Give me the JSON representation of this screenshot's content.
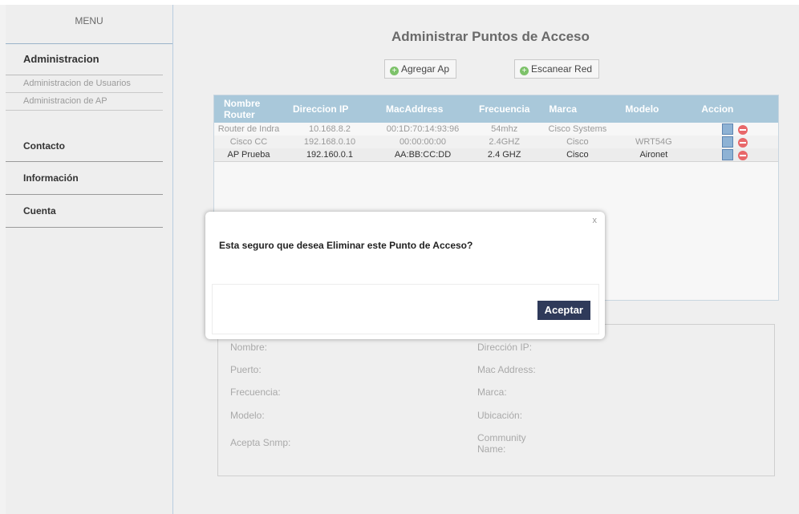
{
  "sidebar": {
    "title": "MENU",
    "admin": "Administracion",
    "sub": [
      "Administracion de Usuarios",
      "Administracion de AP"
    ],
    "contacto": "Contacto",
    "informacion": "Información",
    "cuenta": "Cuenta"
  },
  "main": {
    "title": "Administrar Puntos de Acceso",
    "add_label": "Agregar Ap",
    "scan_label": "Escanear Red",
    "columns": [
      "Nombre Router",
      "Direccion IP",
      "MacAddress",
      "Frecuencia",
      "Marca",
      "Modelo",
      "Accion"
    ],
    "rows": [
      [
        "Router de Indra",
        "10.168.8.2",
        "00:1D:70:14:93:96",
        "54mhz",
        "Cisco Systems",
        ""
      ],
      [
        "Cisco CC",
        "192.168.0.10",
        "00:00:00:00",
        "2.4GHZ",
        "Cisco",
        "WRT54G"
      ],
      [
        "AP Prueba",
        "192.160.0.1",
        "AA:BB:CC:DD",
        "2.4 GHZ",
        "Cisco",
        "Aironet"
      ]
    ]
  },
  "detail": {
    "nombre": "Nombre:",
    "puerto": "Puerto:",
    "frecuencia": "Frecuencia:",
    "modelo": "Modelo:",
    "snmp": "Acepta Snmp:",
    "ip": "Dirección IP:",
    "mac": "Mac Address:",
    "marca": "Marca:",
    "ubicacion": "Ubicación:",
    "community": "Community Name:"
  },
  "modal": {
    "close": "x",
    "message": "Esta seguro que desea Eliminar este Punto de Acceso?",
    "accept": "Aceptar"
  },
  "colors": {
    "header_bg": "#a9c8da",
    "accept_bg": "#2f3a5a",
    "delete_icon": "#e8686a",
    "add_icon": "#7dc26a"
  }
}
